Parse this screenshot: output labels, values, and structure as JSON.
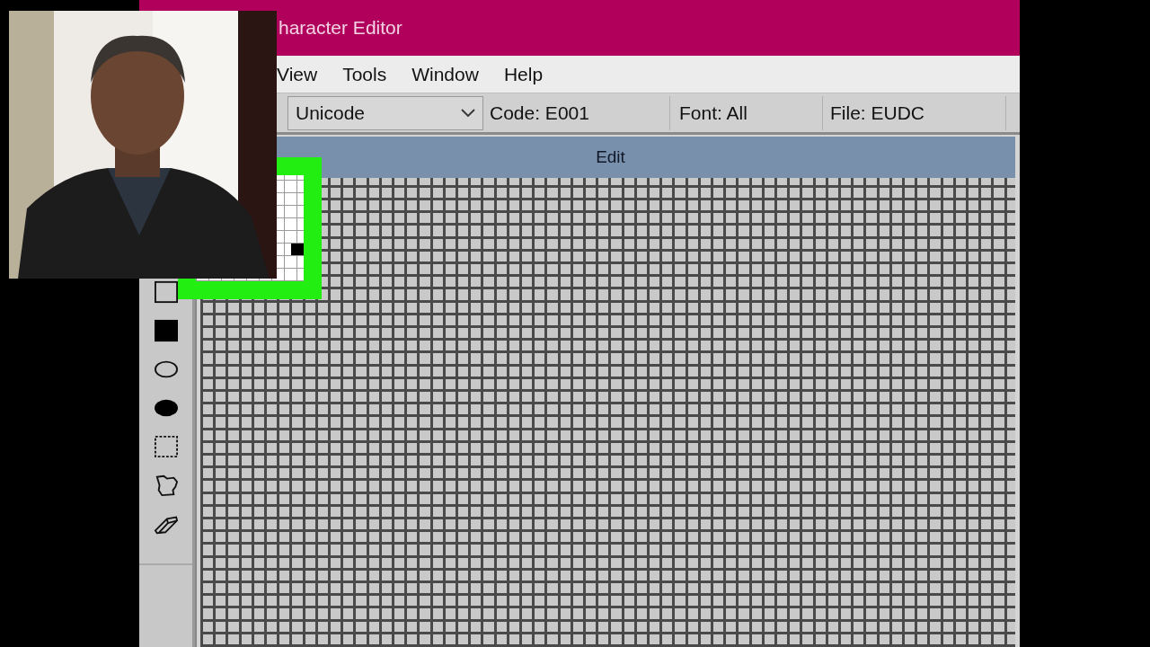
{
  "window": {
    "title": "haracter Editor"
  },
  "menu": [
    "View",
    "Tools",
    "Window",
    "Help"
  ],
  "toolbar": {
    "code_set": "Unicode",
    "code": "Code: E001",
    "font": "Font: All",
    "file": "File: EUDC"
  },
  "edit_panel": {
    "title": "Edit"
  }
}
